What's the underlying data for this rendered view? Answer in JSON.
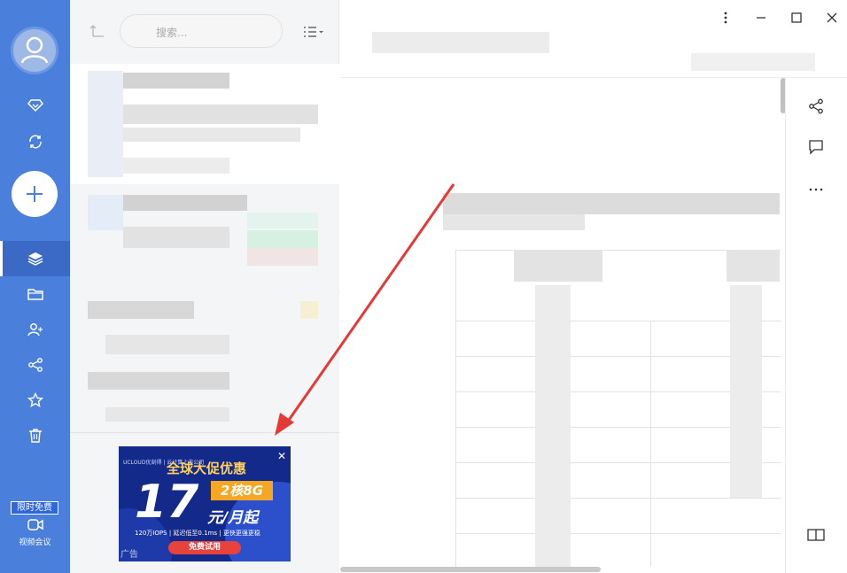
{
  "sidebar": {
    "items": [
      {
        "name": "vip",
        "icon": "diamond-icon"
      },
      {
        "name": "sync",
        "icon": "sync-icon"
      },
      {
        "name": "add",
        "icon": "plus-icon"
      },
      {
        "name": "notebooks",
        "icon": "layers-icon",
        "active": true
      },
      {
        "name": "folders",
        "icon": "folder-icon"
      },
      {
        "name": "collaboration",
        "icon": "users-icon"
      },
      {
        "name": "shared",
        "icon": "share-icon"
      },
      {
        "name": "favorites",
        "icon": "star-icon"
      },
      {
        "name": "trash",
        "icon": "trash-icon"
      }
    ],
    "promo_badge": "限时免费",
    "video_label": "视频会议"
  },
  "list": {
    "search_placeholder": "搜索...",
    "ad": {
      "brand": "UCLOUD优刻得 | 云计算上市公司",
      "headline": "全球大促优惠",
      "big_number": "17",
      "tag": "2核8G",
      "price_unit": "元/月起",
      "specs": "120万IOPS | 延迟低至0.1ms | 更快更强更稳",
      "cta": "免费试用",
      "ad_mark": "广告"
    }
  },
  "colors": {
    "rail": "#4a7fdc",
    "rail_active": "#3a6ac5",
    "list_bg": "#f4f5f7",
    "ad_bg": "#142a8a",
    "ad_accent": "#f5a623",
    "ad_cta": "#e8423c",
    "arrow": "#e53935"
  }
}
